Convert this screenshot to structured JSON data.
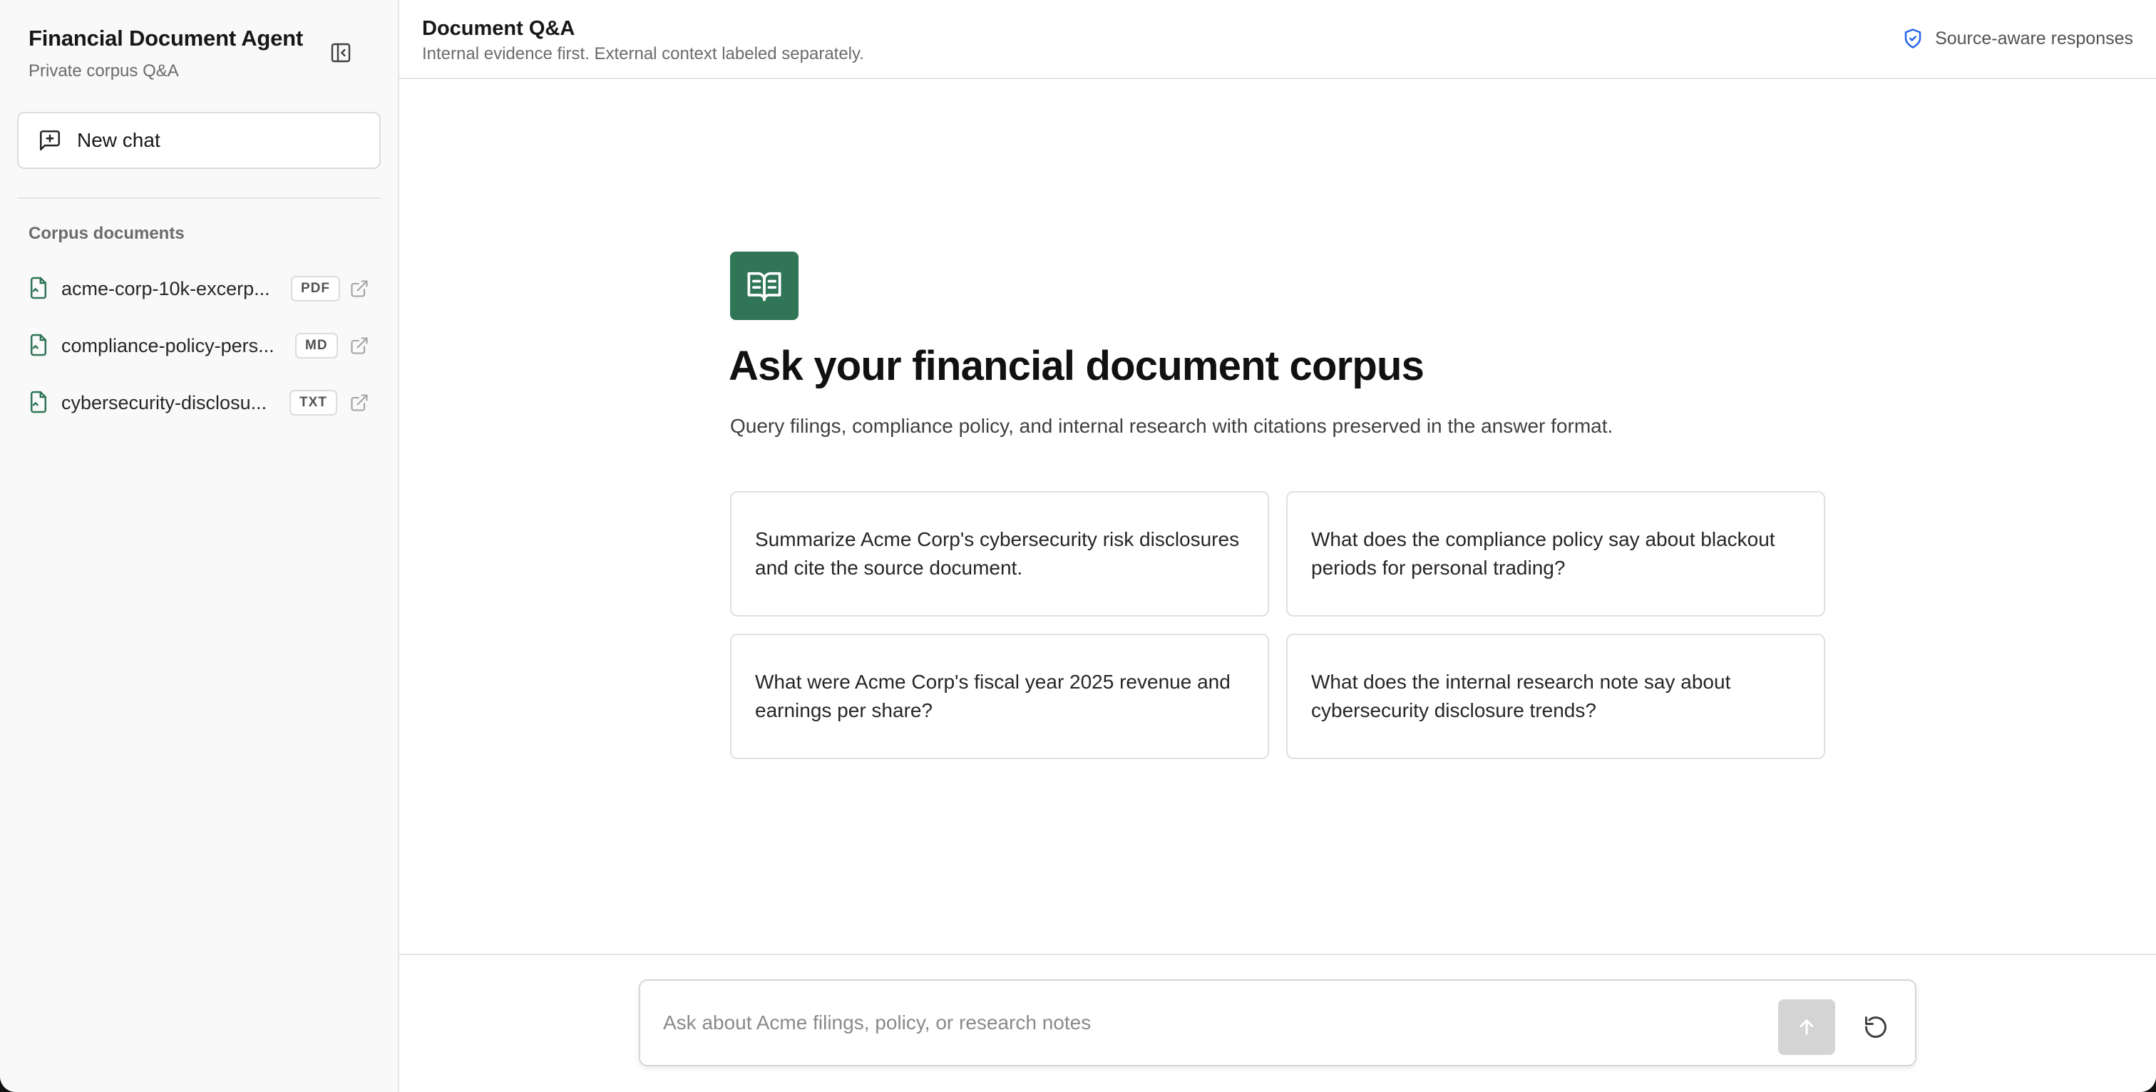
{
  "sidebar": {
    "app_title": "Financial Document Agent",
    "app_subtitle": "Private corpus Q&A",
    "collapse_icon": "panel-collapse-icon",
    "new_chat_label": "New chat",
    "new_chat_icon": "message-plus-icon",
    "corpus_heading": "Corpus documents",
    "documents": [
      {
        "name": "acme-corp-10k-excerp...",
        "type": "PDF"
      },
      {
        "name": "compliance-policy-pers...",
        "type": "MD"
      },
      {
        "name": "cybersecurity-disclosu...",
        "type": "TXT"
      }
    ]
  },
  "header": {
    "title": "Document Q&A",
    "subtitle": "Internal evidence first. External context labeled separately.",
    "badge_label": "Source-aware responses",
    "badge_icon": "shield-check-icon"
  },
  "main": {
    "hero_icon": "open-book-icon",
    "title": "Ask your financial document corpus",
    "description": "Query filings, compliance policy, and internal research with citations preserved in the answer format.",
    "suggestions": [
      "Summarize Acme Corp's cybersecurity risk disclosures and cite the source document.",
      "What does the compliance policy say about blackout periods for personal trading?",
      "What were Acme Corp's fiscal year 2025 revenue and earnings per share?",
      "What does the internal research note say about cybersecurity disclosure trends?"
    ]
  },
  "composer": {
    "placeholder": "Ask about Acme filings, policy, or research notes",
    "value": "",
    "send_icon": "arrow-up-icon",
    "reset_icon": "refresh-icon"
  },
  "colors": {
    "accent": "#2f7556",
    "shield": "#2563eb",
    "border": "#e5e5e5"
  }
}
